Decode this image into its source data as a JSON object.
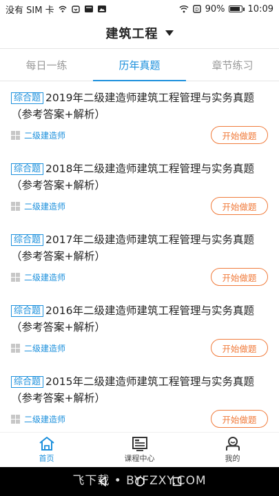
{
  "status_bar": {
    "carrier": "没有 SIM 卡",
    "battery": "90%",
    "time": "10:09"
  },
  "header": {
    "title": "建筑工程"
  },
  "tabs": [
    {
      "label": "每日一练",
      "active": false
    },
    {
      "label": "历年真题",
      "active": true
    },
    {
      "label": "章节练习",
      "active": false
    }
  ],
  "items": [
    {
      "tag": "综合题",
      "title": "2019年二级建造师建筑工程管理与实务真题（参考答案+解析）",
      "category": "二级建造师",
      "button": "开始做题"
    },
    {
      "tag": "综合题",
      "title": "2018年二级建造师建筑工程管理与实务真题（参考答案+解析）",
      "category": "二级建造师",
      "button": "开始做题"
    },
    {
      "tag": "综合题",
      "title": "2017年二级建造师建筑工程管理与实务真题（参考答案+解析）",
      "category": "二级建造师",
      "button": "开始做题"
    },
    {
      "tag": "综合题",
      "title": "2016年二级建造师建筑工程管理与实务真题（参考答案+解析）",
      "category": "二级建造师",
      "button": "开始做题"
    },
    {
      "tag": "综合题",
      "title": "2015年二级建造师建筑工程管理与实务真题（参考答案+解析）",
      "category": "二级建造师",
      "button": "开始做题"
    }
  ],
  "bottom_nav": [
    {
      "label": "首页",
      "icon": "home-icon",
      "active": true
    },
    {
      "label": "课程中心",
      "icon": "course-icon",
      "active": false
    },
    {
      "label": "我的",
      "icon": "profile-icon",
      "active": false
    }
  ],
  "watermark": "飞下载 • BYFZXY.COM",
  "colors": {
    "accent": "#1a8fdc",
    "button": "#f07a3a"
  }
}
